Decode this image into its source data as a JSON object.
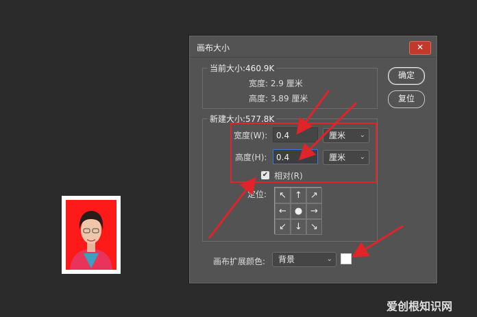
{
  "dialog": {
    "title": "画布大小",
    "close_icon": "close-icon",
    "current": {
      "label": "当前大小:460.9K",
      "width_text": "宽度:  2.9 厘米",
      "height_text": "高度:  3.89 厘米"
    },
    "new": {
      "label": "新建大小:577.8K",
      "width_label": "宽度(W):",
      "width_value": "0.4",
      "height_label": "高度(H):",
      "height_value": "0.4",
      "unit_width": "厘米",
      "unit_height": "厘米",
      "relative_label": "相对(R)",
      "relative_checked": true,
      "anchor_label": "定位:"
    },
    "buttons": {
      "ok": "确定",
      "reset": "复位"
    },
    "extension": {
      "label": "画布扩展颜色:",
      "value": "背景",
      "swatch_color": "#ffffff"
    }
  },
  "watermark": "爱创根知识网",
  "colors": {
    "accent_red": "#e0242a",
    "focus_blue": "#2f7de0"
  }
}
